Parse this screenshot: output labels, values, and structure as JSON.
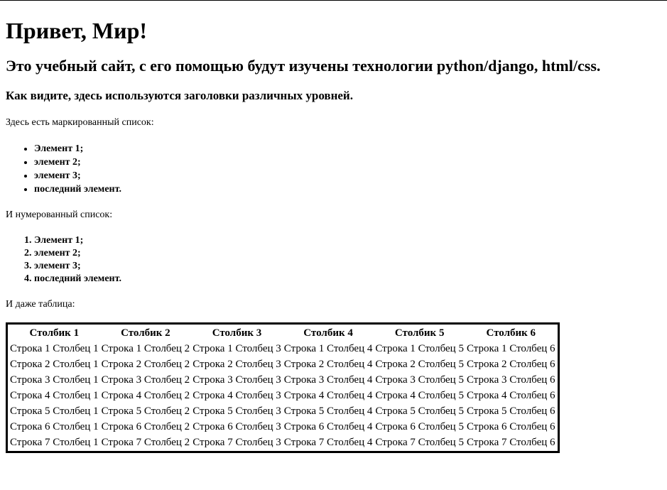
{
  "heading1": "Привет, Мир!",
  "heading2": "Это учебный сайт, с его помощью будут изучены технологии python/django, html/css.",
  "heading3": "Как видите, здесь используются заголовки различных уровней.",
  "bullet_intro": "Здесь есть маркированный список:",
  "bullet_items": [
    "Элемент 1;",
    "элемент 2;",
    "элемент 3;",
    "последний элемент."
  ],
  "numbered_intro": "И нумерованный список:",
  "numbered_items": [
    "Элемент 1;",
    "элемент 2;",
    "элемент 3;",
    "последний элемент."
  ],
  "table_intro": "И даже таблица:",
  "table": {
    "headers": [
      "Столбик 1",
      "Столбик 2",
      "Столбик 3",
      "Столбик 4",
      "Столбик 5",
      "Столбик 6"
    ],
    "rows": [
      [
        "Строка 1 Столбец 1",
        "Строка 1 Столбец 2",
        "Строка 1 Столбец 3",
        "Строка 1 Столбец 4",
        "Строка 1 Столбец 5",
        "Строка 1 Столбец 6"
      ],
      [
        "Строка 2 Столбец 1",
        "Строка 2 Столбец 2",
        "Строка 2 Столбец 3",
        "Строка 2 Столбец 4",
        "Строка 2 Столбец 5",
        "Строка 2 Столбец 6"
      ],
      [
        "Строка 3 Столбец 1",
        "Строка 3 Столбец 2",
        "Строка 3 Столбец 3",
        "Строка 3 Столбец 4",
        "Строка 3 Столбец 5",
        "Строка 3 Столбец 6"
      ],
      [
        "Строка 4 Столбец 1",
        "Строка 4 Столбец 2",
        "Строка 4 Столбец 3",
        "Строка 4 Столбец 4",
        "Строка 4 Столбец 5",
        "Строка 4 Столбец 6"
      ],
      [
        "Строка 5 Столбец 1",
        "Строка 5 Столбец 2",
        "Строка 5 Столбец 3",
        "Строка 5 Столбец 4",
        "Строка 5 Столбец 5",
        "Строка 5 Столбец 6"
      ],
      [
        "Строка 6 Столбец 1",
        "Строка 6 Столбец 2",
        "Строка 6 Столбец 3",
        "Строка 6 Столбец 4",
        "Строка 6 Столбец 5",
        "Строка 6 Столбец 6"
      ],
      [
        "Строка 7 Столбец 1",
        "Строка 7 Столбец 2",
        "Строка 7 Столбец 3",
        "Строка 7 Столбец 4",
        "Строка 7 Столбец 5",
        "Строка 7 Столбец 6"
      ]
    ]
  }
}
